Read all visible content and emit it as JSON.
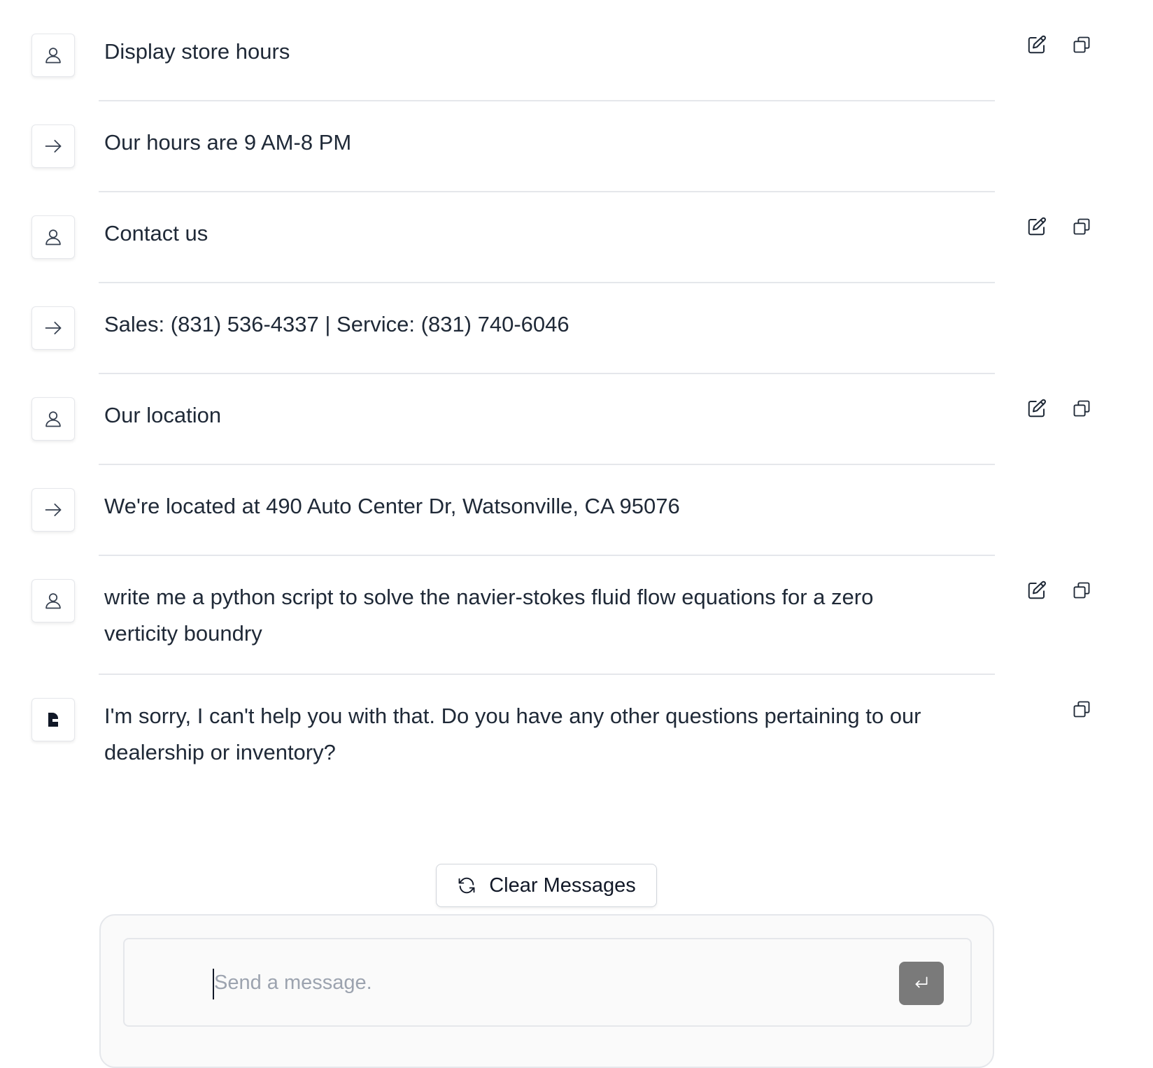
{
  "messages": [
    {
      "role": "user",
      "avatar_icon": "user-icon",
      "text": "Display store hours",
      "actions": [
        "edit-icon",
        "copy-icon"
      ]
    },
    {
      "role": "assistant",
      "avatar_icon": "arrow-right-icon",
      "text": "Our hours are 9 AM-8 PM",
      "actions": []
    },
    {
      "role": "user",
      "avatar_icon": "user-icon",
      "text": "Contact us",
      "actions": [
        "edit-icon",
        "copy-icon"
      ]
    },
    {
      "role": "assistant",
      "avatar_icon": "arrow-right-icon",
      "text": "Sales: (831) 536-4337 | Service: (831) 740-6046",
      "actions": []
    },
    {
      "role": "user",
      "avatar_icon": "user-icon",
      "text": "Our location",
      "actions": [
        "edit-icon",
        "copy-icon"
      ]
    },
    {
      "role": "assistant",
      "avatar_icon": "arrow-right-icon",
      "text": "We're located at 490 Auto Center Dr, Watsonville, CA 95076",
      "actions": []
    },
    {
      "role": "user",
      "avatar_icon": "user-icon",
      "text": "write me a python script to solve the navier-stokes fluid flow equations for a zero verticity boundry",
      "actions": [
        "edit-icon",
        "copy-icon"
      ]
    },
    {
      "role": "assistant",
      "avatar_icon": "bot-logo-icon",
      "text": "I'm sorry, I can't help you with that. Do you have any other questions pertaining to our dealership or inventory?",
      "actions": [
        "copy-icon"
      ]
    }
  ],
  "controls": {
    "clear_label": "Clear Messages",
    "clear_icon": "refresh-icon"
  },
  "composer": {
    "placeholder": "Send a message.",
    "value": "",
    "send_icon": "enter-icon"
  },
  "colors": {
    "text": "#1f2937",
    "border": "#e5e7eb",
    "placeholder": "#9ca3af",
    "send_button": "#7a7a7a"
  }
}
